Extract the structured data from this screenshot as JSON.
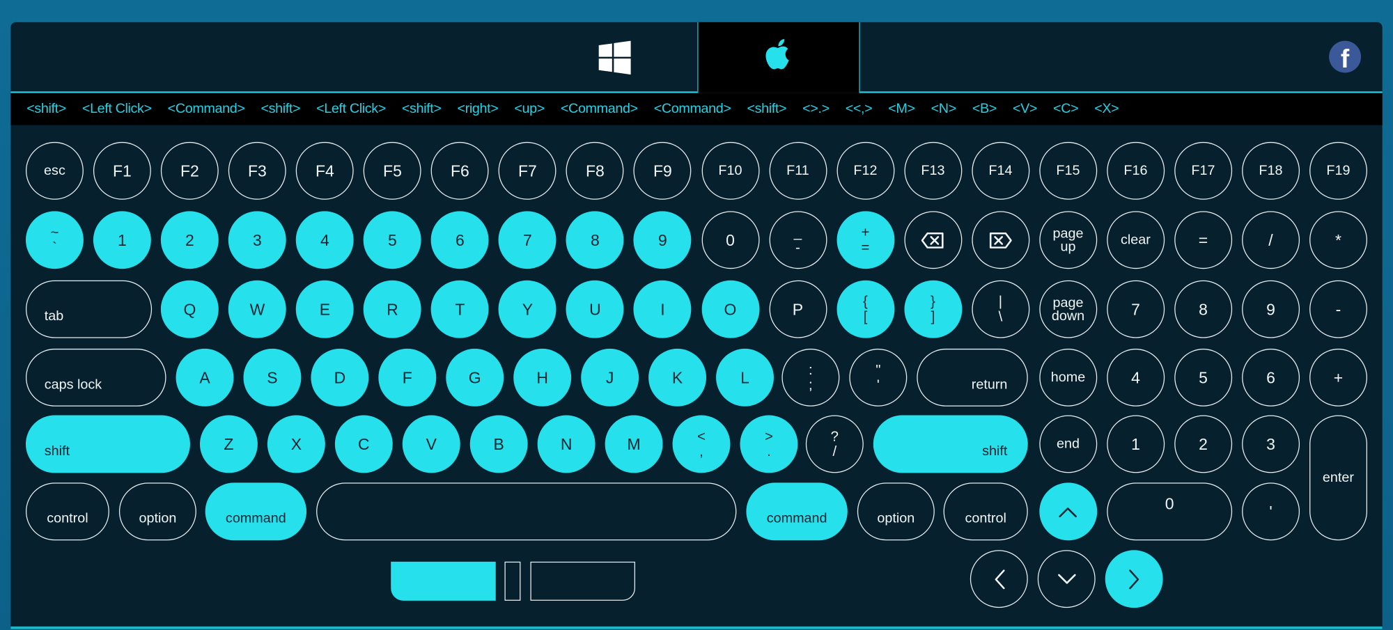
{
  "tabs": {
    "windows": "windows-icon",
    "mac": "apple-icon",
    "active": "mac",
    "facebook_icon": "facebook-icon",
    "facebook_letter": "f"
  },
  "shortcut_history": [
    "<shift>",
    "<Left Click>",
    "<Command>",
    "<shift>",
    "<Left Click>",
    "<shift>",
    "<right>",
    "<up>",
    "<Command>",
    "<Command>",
    "<shift>",
    "<>.>",
    "<<,>",
    "<M>",
    "<N>",
    "<B>",
    "<V>",
    "<C>",
    "<X>"
  ],
  "colors": {
    "accent": "#26e0ec",
    "panel": "#06202e",
    "background": "#0e6690",
    "strip": "#000000"
  },
  "keyboard": {
    "rows": [
      [
        {
          "l": "esc"
        },
        {
          "l": "F1"
        },
        {
          "l": "F2"
        },
        {
          "l": "F3"
        },
        {
          "l": "F4"
        },
        {
          "l": "F5"
        },
        {
          "l": "F6"
        },
        {
          "l": "F7"
        },
        {
          "l": "F8"
        },
        {
          "l": "F9"
        },
        {
          "l": "F10"
        },
        {
          "l": "F11"
        },
        {
          "l": "F12"
        },
        {
          "l": "F13"
        },
        {
          "l": "F14"
        },
        {
          "l": "F15"
        },
        {
          "l": "F16"
        },
        {
          "l": "F17"
        },
        {
          "l": "F18"
        },
        {
          "l": "F19"
        }
      ],
      [
        {
          "t": "~",
          "b": "`",
          "on": true
        },
        {
          "l": "1",
          "on": true
        },
        {
          "l": "2",
          "on": true
        },
        {
          "l": "3",
          "on": true
        },
        {
          "l": "4",
          "on": true
        },
        {
          "l": "5",
          "on": true
        },
        {
          "l": "6",
          "on": true
        },
        {
          "l": "7",
          "on": true
        },
        {
          "l": "8",
          "on": true
        },
        {
          "l": "9",
          "on": true
        },
        {
          "l": "0"
        },
        {
          "t": "_",
          "b": "-"
        },
        {
          "t": "+",
          "b": "=",
          "on": true
        },
        {
          "icon": "backspace-icon"
        },
        {
          "icon": "forward-delete-icon"
        },
        {
          "t": "page",
          "b": "up",
          "words": true
        },
        {
          "l": "clear"
        },
        {
          "l": "="
        },
        {
          "l": "/"
        },
        {
          "l": "*"
        }
      ],
      [
        {
          "l": "tab"
        },
        {
          "l": "Q",
          "on": true
        },
        {
          "l": "W",
          "on": true
        },
        {
          "l": "E",
          "on": true
        },
        {
          "l": "R",
          "on": true
        },
        {
          "l": "T",
          "on": true
        },
        {
          "l": "Y",
          "on": true
        },
        {
          "l": "U",
          "on": true
        },
        {
          "l": "I",
          "on": true
        },
        {
          "l": "O",
          "on": true
        },
        {
          "l": "P"
        },
        {
          "t": "{",
          "b": "[",
          "on": true
        },
        {
          "t": "}",
          "b": "]",
          "on": true
        },
        {
          "t": "|",
          "b": "\\"
        },
        {
          "t": "page",
          "b": "down",
          "words": true
        },
        {
          "l": "7"
        },
        {
          "l": "8"
        },
        {
          "l": "9"
        },
        {
          "l": "-"
        }
      ],
      [
        {
          "l": "caps lock"
        },
        {
          "l": "A",
          "on": true
        },
        {
          "l": "S",
          "on": true
        },
        {
          "l": "D",
          "on": true
        },
        {
          "l": "F",
          "on": true
        },
        {
          "l": "G",
          "on": true
        },
        {
          "l": "H",
          "on": true
        },
        {
          "l": "J",
          "on": true
        },
        {
          "l": "K",
          "on": true
        },
        {
          "l": "L",
          "on": true
        },
        {
          "t": ":",
          "b": ";"
        },
        {
          "t": "\"",
          "b": "'"
        },
        {
          "l": "return"
        },
        {
          "l": "home"
        },
        {
          "l": "4"
        },
        {
          "l": "5"
        },
        {
          "l": "6"
        },
        {
          "l": "+"
        }
      ],
      [
        {
          "l": "shift",
          "on": true
        },
        {
          "l": "Z",
          "on": true
        },
        {
          "l": "X",
          "on": true
        },
        {
          "l": "C",
          "on": true
        },
        {
          "l": "V",
          "on": true
        },
        {
          "l": "B",
          "on": true
        },
        {
          "l": "N",
          "on": true
        },
        {
          "l": "M",
          "on": true
        },
        {
          "t": "<",
          "b": ",",
          "on": true
        },
        {
          "t": ">",
          "b": ".",
          "on": true
        },
        {
          "t": "?",
          "b": "/"
        },
        {
          "l": "shift",
          "on": true
        },
        {
          "l": "end"
        },
        {
          "l": "1"
        },
        {
          "l": "2"
        },
        {
          "l": "3"
        },
        {
          "l": "enter"
        }
      ],
      [
        {
          "l": "control"
        },
        {
          "l": "option"
        },
        {
          "l": "command",
          "on": true
        },
        {
          "l": ""
        },
        {
          "l": "command",
          "on": true
        },
        {
          "l": "option"
        },
        {
          "l": "control"
        },
        {
          "icon": "arrow-up-icon",
          "on": true
        },
        {
          "l": "0"
        },
        {
          "l": "'"
        }
      ],
      [
        {
          "icon": "arrow-left-icon"
        },
        {
          "icon": "arrow-down-icon"
        },
        {
          "icon": "arrow-right-icon",
          "on": true
        }
      ]
    ]
  },
  "layout_toggle": {
    "left_active": true
  }
}
